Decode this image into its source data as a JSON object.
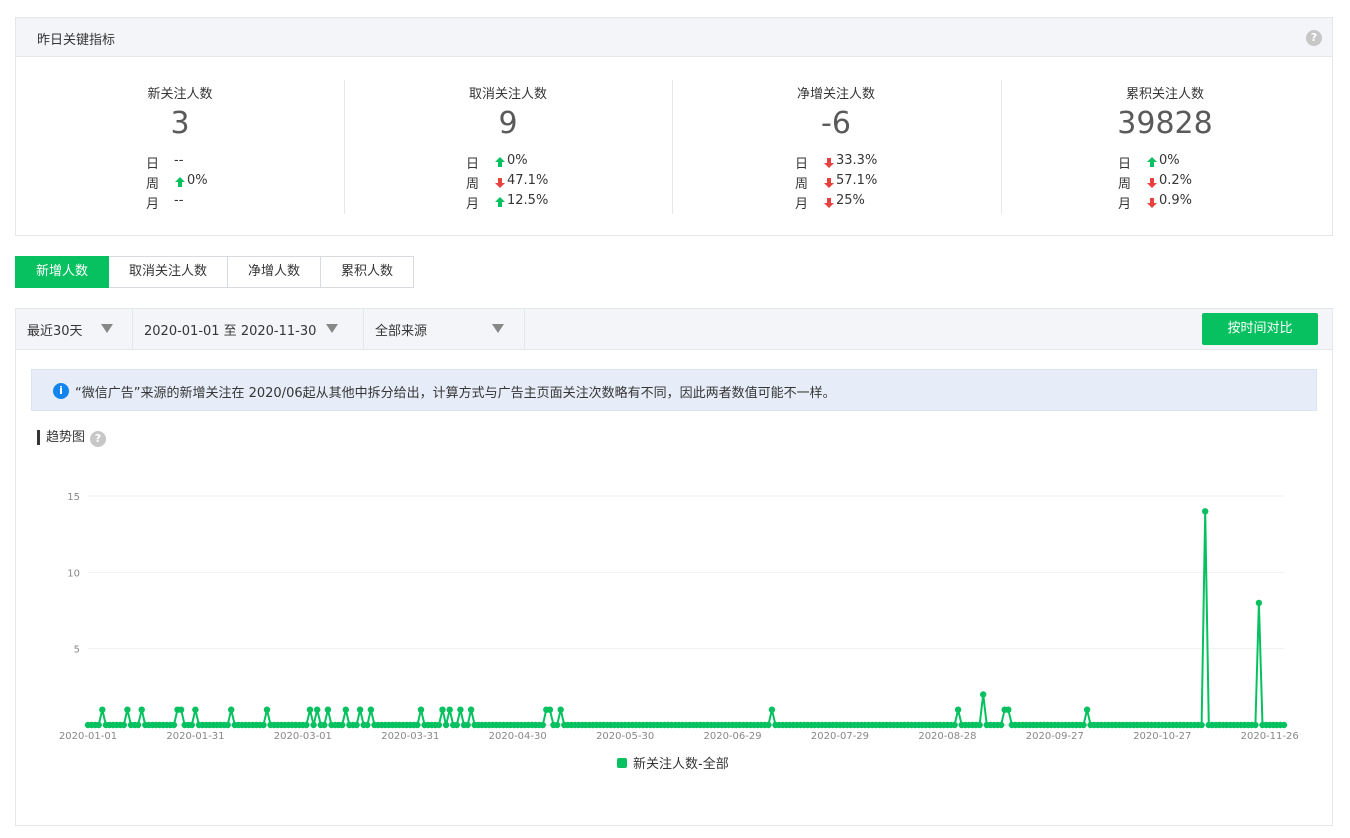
{
  "kpi_panel": {
    "title": "昨日关键指标",
    "help_icon": "question-circle-icon",
    "cards": [
      {
        "label": "新关注人数",
        "value": "3",
        "rows": [
          {
            "period": "日",
            "direction": "none",
            "change": "--"
          },
          {
            "period": "周",
            "direction": "up",
            "change": "0%"
          },
          {
            "period": "月",
            "direction": "none",
            "change": "--"
          }
        ]
      },
      {
        "label": "取消关注人数",
        "value": "9",
        "rows": [
          {
            "period": "日",
            "direction": "up",
            "change": "0%"
          },
          {
            "period": "周",
            "direction": "down",
            "change": "47.1%"
          },
          {
            "period": "月",
            "direction": "up",
            "change": "12.5%"
          }
        ]
      },
      {
        "label": "净增关注人数",
        "value": "-6",
        "rows": [
          {
            "period": "日",
            "direction": "down",
            "change": "33.3%"
          },
          {
            "period": "周",
            "direction": "down",
            "change": "57.1%"
          },
          {
            "period": "月",
            "direction": "down",
            "change": "25%"
          }
        ]
      },
      {
        "label": "累积关注人数",
        "value": "39828",
        "rows": [
          {
            "period": "日",
            "direction": "up",
            "change": "0%"
          },
          {
            "period": "周",
            "direction": "down",
            "change": "0.2%"
          },
          {
            "period": "月",
            "direction": "down",
            "change": "0.9%"
          }
        ]
      }
    ]
  },
  "tabs": [
    {
      "label": "新增人数",
      "active": true
    },
    {
      "label": "取消关注人数",
      "active": false
    },
    {
      "label": "净增人数",
      "active": false
    },
    {
      "label": "累积人数",
      "active": false
    }
  ],
  "filters": {
    "range_preset": "最近30天",
    "date_range": "2020-01-01 至 2020-11-30",
    "source": "全部来源",
    "compare_button": "按时间对比"
  },
  "notice": {
    "icon": "info-icon",
    "text": "“微信广告”来源的新增关注在 2020/06起从其他中拆分给出，计算方式与广告主页面关注次数略有不同，因此两者数值可能不一样。"
  },
  "trend": {
    "title": "趋势图",
    "help_icon": "question-circle-icon"
  },
  "colors": {
    "accent": "#07c160",
    "up": "#07c160",
    "down": "#e64340",
    "info": "#1485ee"
  },
  "chart_data": {
    "type": "line",
    "x_start": "2020-01-01",
    "x_end": "2020-11-30",
    "x_tick_labels": [
      "2020-01-01",
      "2020-01-31",
      "2020-03-01",
      "2020-03-31",
      "2020-04-30",
      "2020-05-30",
      "2020-06-29",
      "2020-07-29",
      "2020-08-28",
      "2020-09-27",
      "2020-10-27",
      "2020-11-26"
    ],
    "y_ticks": [
      5,
      10,
      15
    ],
    "ylim": [
      0,
      16
    ],
    "grid": true,
    "legend_position": "bottom",
    "series": [
      {
        "name": "新关注人数-全部",
        "color": "#07c160",
        "points": [
          {
            "date": "2020-01-05",
            "value": 1
          },
          {
            "date": "2020-01-12",
            "value": 1
          },
          {
            "date": "2020-01-16",
            "value": 1
          },
          {
            "date": "2020-01-26",
            "value": 1
          },
          {
            "date": "2020-01-27",
            "value": 1
          },
          {
            "date": "2020-01-31",
            "value": 1
          },
          {
            "date": "2020-02-10",
            "value": 1
          },
          {
            "date": "2020-02-20",
            "value": 1
          },
          {
            "date": "2020-03-03",
            "value": 1
          },
          {
            "date": "2020-03-05",
            "value": 1
          },
          {
            "date": "2020-03-08",
            "value": 1
          },
          {
            "date": "2020-03-13",
            "value": 1
          },
          {
            "date": "2020-03-17",
            "value": 1
          },
          {
            "date": "2020-03-20",
            "value": 1
          },
          {
            "date": "2020-04-03",
            "value": 1
          },
          {
            "date": "2020-04-09",
            "value": 1
          },
          {
            "date": "2020-04-11",
            "value": 1
          },
          {
            "date": "2020-04-14",
            "value": 1
          },
          {
            "date": "2020-04-17",
            "value": 1
          },
          {
            "date": "2020-05-08",
            "value": 1
          },
          {
            "date": "2020-05-09",
            "value": 1
          },
          {
            "date": "2020-05-12",
            "value": 1
          },
          {
            "date": "2020-07-10",
            "value": 1
          },
          {
            "date": "2020-08-31",
            "value": 1
          },
          {
            "date": "2020-09-07",
            "value": 2
          },
          {
            "date": "2020-09-13",
            "value": 1
          },
          {
            "date": "2020-09-14",
            "value": 1
          },
          {
            "date": "2020-10-06",
            "value": 1
          },
          {
            "date": "2020-11-08",
            "value": 14
          },
          {
            "date": "2020-11-23",
            "value": 8
          }
        ]
      }
    ]
  }
}
